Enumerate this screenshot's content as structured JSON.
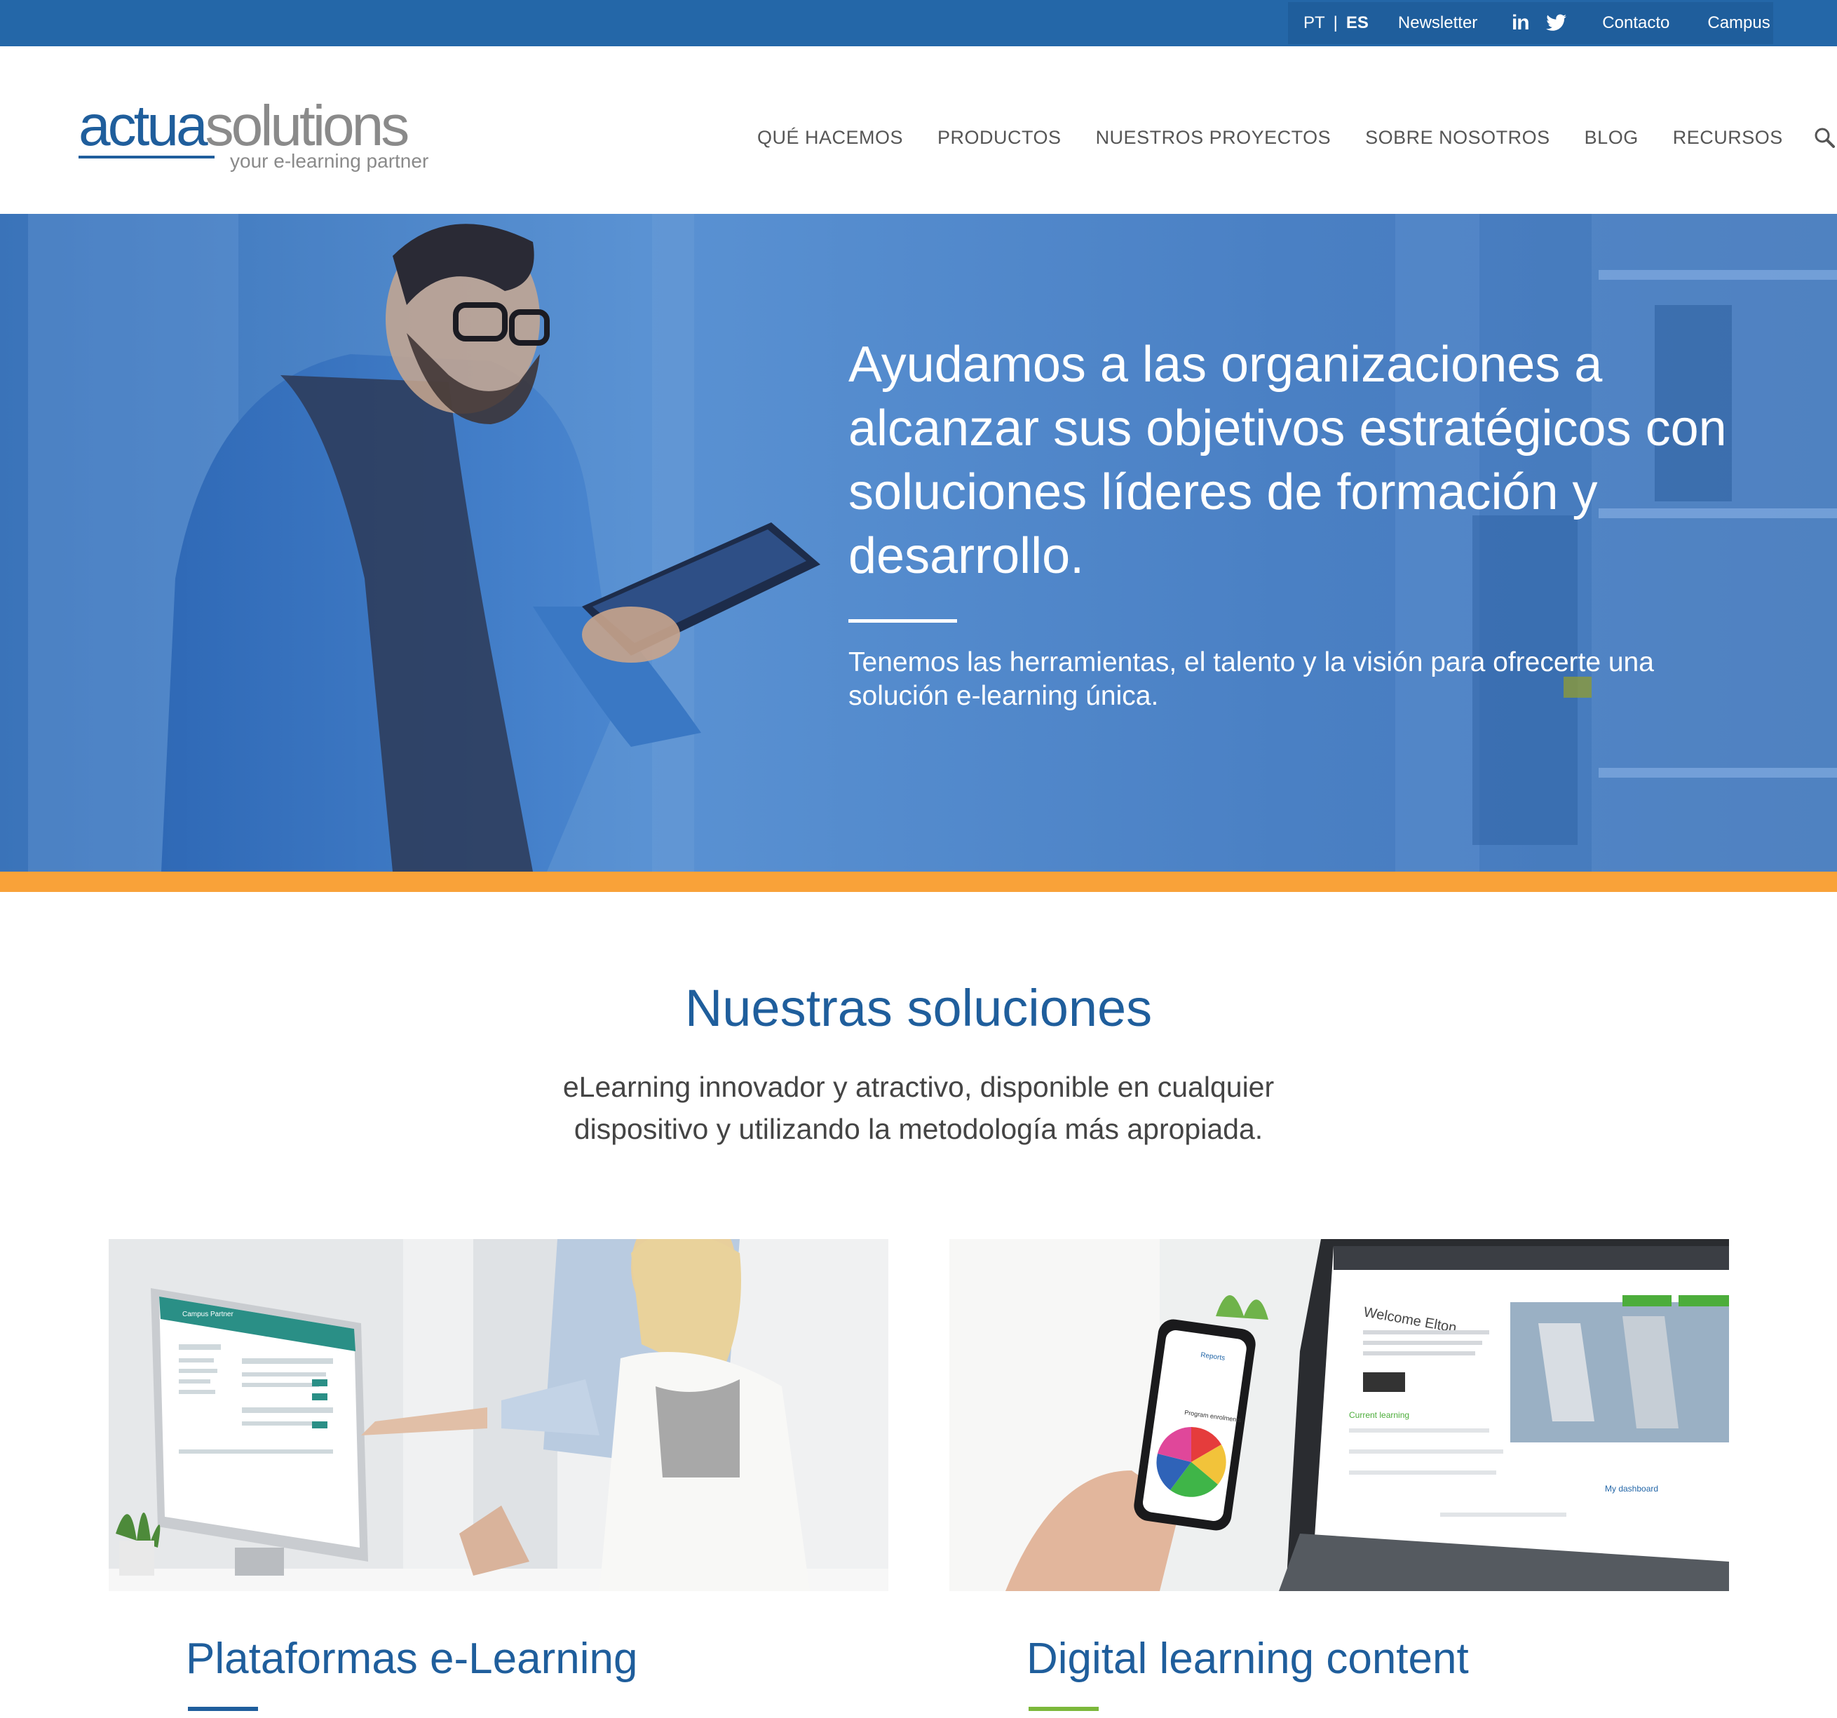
{
  "topbar": {
    "lang_pt": "PT",
    "lang_sep": "|",
    "lang_es": "ES",
    "newsletter": "Newsletter",
    "linkedin_icon": "linkedin-icon",
    "twitter_icon": "twitter-icon",
    "contacto": "Contacto",
    "campus": "Campus"
  },
  "logo": {
    "part1": "actua",
    "part2": "solutions",
    "tagline": "your e-learning partner"
  },
  "nav": {
    "items": [
      "QUÉ HACEMOS",
      "PRODUCTOS",
      "NUESTROS PROYECTOS",
      "SOBRE NOSOTROS",
      "BLOG",
      "RECURSOS"
    ],
    "search_icon": "search-icon"
  },
  "hero": {
    "title": "Ayudamos a las organizaciones a alcanzar sus objetivos estratégicos con soluciones líderes de formación y desarrollo.",
    "subtitle": "Tenemos las herramientas, el talento y la visión para ofrecerte una solución e-learning única."
  },
  "solutions": {
    "title": "Nuestras soluciones",
    "subtitle": "eLearning innovador y atractivo, disponible en cualquier dispositivo y utilizando la metodología más apropiada.",
    "cards": [
      {
        "title": "Plataformas e-Learning",
        "screen_brand": "Campus Partner"
      },
      {
        "title": "Digital learning content",
        "screen_welcome": "Welcome Elton",
        "screen_current": "Current learning",
        "screen_dashboard": "My dashboard",
        "phone_reports": "Reports",
        "phone_enrolments": "Program enrolments"
      }
    ]
  },
  "colors": {
    "brand_blue": "#1f5e9c",
    "topbar_blue": "#2467a8",
    "orange": "#f9a239",
    "green": "#7cb83b"
  }
}
